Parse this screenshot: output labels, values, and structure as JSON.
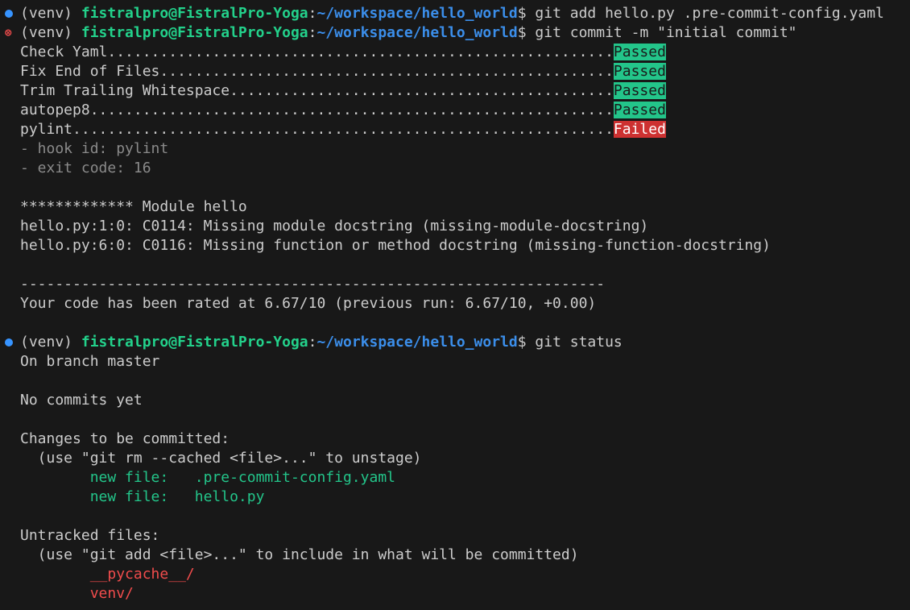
{
  "colors": {
    "background": "#181818",
    "text": "#cccccc",
    "prompt_user": "#23d18b",
    "prompt_path": "#3b8eea",
    "passed_bg": "#23c58a",
    "failed_bg": "#cd3131",
    "staged_file": "#23c58a",
    "untracked_file": "#f14c4c",
    "decoration_dot": "#3794ff",
    "decoration_error": "#f14c4c"
  },
  "prompt": {
    "venv": "(venv) ",
    "user_host": "fistralpro@FistralPro-Yoga",
    "colon": ":",
    "path": "~/workspace/hello_world",
    "dollar": "$"
  },
  "commands": {
    "add": " git add hello.py .pre-commit-config.yaml",
    "commit": " git commit -m \"initial commit\"",
    "status": " git status"
  },
  "hooks": [
    {
      "name": "Check Yaml",
      "dots": "..........................................................",
      "status": "Passed"
    },
    {
      "name": "Fix End of Files",
      "dots": "....................................................",
      "status": "Passed"
    },
    {
      "name": "Trim Trailing Whitespace",
      "dots": "............................................",
      "status": "Passed"
    },
    {
      "name": "autopep8",
      "dots": "............................................................",
      "status": "Passed"
    },
    {
      "name": "pylint",
      "dots": "..............................................................",
      "status": "Failed"
    }
  ],
  "hook_info": {
    "hook_id": "- hook id: pylint",
    "exit_code": "- exit code: 16"
  },
  "pylint_output": {
    "module_header": "************* Module hello",
    "msg1": "hello.py:1:0: C0114: Missing module docstring (missing-module-docstring)",
    "msg2": "hello.py:6:0: C0116: Missing function or method docstring (missing-function-docstring)",
    "separator": "-------------------------------------------------------------------",
    "rating": "Your code has been rated at 6.67/10 (previous run: 6.67/10, +0.00)"
  },
  "status_output": {
    "branch": "On branch master",
    "no_commits": "No commits yet",
    "changes_header": "Changes to be committed:",
    "changes_hint": "  (use \"git rm --cached <file>...\" to unstage)",
    "staged_files": [
      "        new file:   .pre-commit-config.yaml",
      "        new file:   hello.py"
    ],
    "untracked_header": "Untracked files:",
    "untracked_hint": "  (use \"git add <file>...\" to include in what will be committed)",
    "untracked_files": [
      "        __pycache__/",
      "        venv/"
    ]
  }
}
